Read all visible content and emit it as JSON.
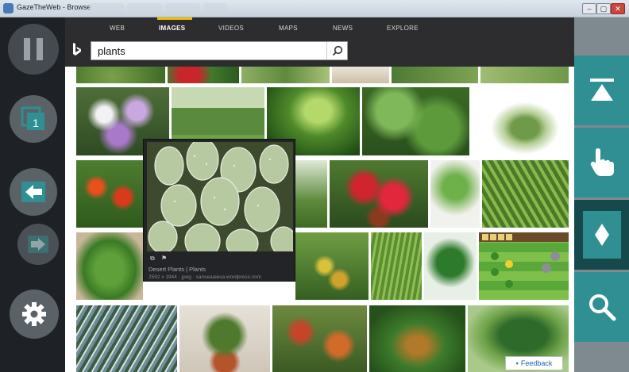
{
  "window": {
    "title": "GazeTheWeb - Browse"
  },
  "nav": {
    "items": [
      {
        "label": "WEB",
        "active": false
      },
      {
        "label": "IMAGES",
        "active": true
      },
      {
        "label": "VIDEOS",
        "active": false
      },
      {
        "label": "MAPS",
        "active": false
      },
      {
        "label": "NEWS",
        "active": false
      },
      {
        "label": "EXPLORE",
        "active": false
      }
    ]
  },
  "search": {
    "value": "plants"
  },
  "left_controls": {
    "tab_count": "1",
    "icons": [
      "pause-icon",
      "tabs-icon",
      "back-icon",
      "forward-icon",
      "settings-icon"
    ]
  },
  "right_controls": {
    "icons": [
      "scroll-to-top-icon",
      "click-hand-icon",
      "scroll-mode-icon",
      "zoom-search-icon"
    ]
  },
  "popup": {
    "caption": "Desert Plants | Plants",
    "meta": "2592 x 1944 · jpeg · sanseaaieva.wordpress.com"
  },
  "feedback": {
    "label": "Feedback"
  },
  "colors": {
    "accent_teal": "#2f8f92",
    "dark_panel": "#1e2226",
    "topbar": "#2d2d30",
    "nav_active_underline": "#f0c000"
  }
}
